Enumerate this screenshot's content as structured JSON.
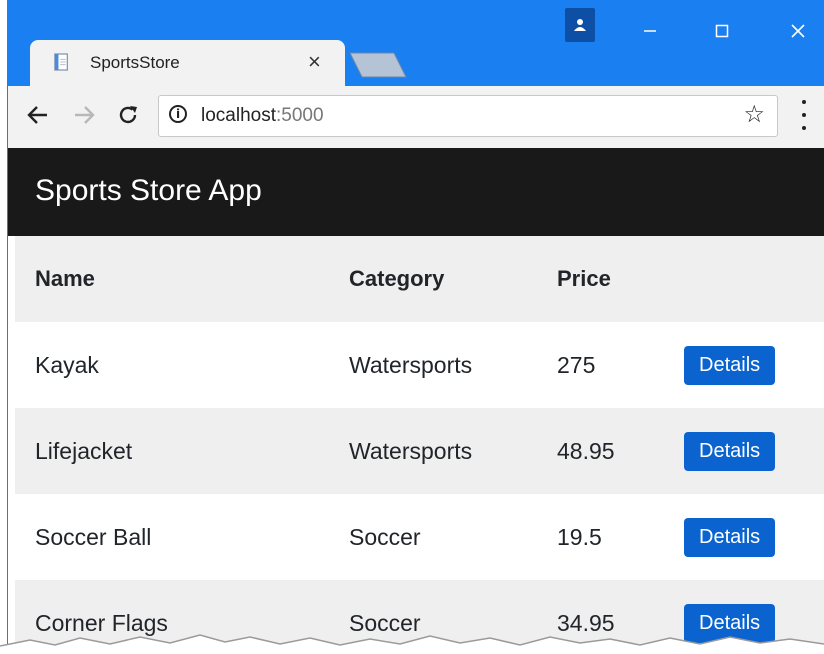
{
  "browser": {
    "tab_title": "SportsStore",
    "tab_close": "×",
    "url_host": "localhost",
    "url_port": ":5000",
    "info_glyph": "i"
  },
  "window_controls": [
    "minimize-icon",
    "maximize-icon",
    "close-icon"
  ],
  "app": {
    "brand": "Sports Store App"
  },
  "table": {
    "headers": [
      "Name",
      "Category",
      "Price"
    ],
    "rows": [
      {
        "name": "Kayak",
        "category": "Watersports",
        "price": "275",
        "action": "Details"
      },
      {
        "name": "Lifejacket",
        "category": "Watersports",
        "price": "48.95",
        "action": "Details"
      },
      {
        "name": "Soccer Ball",
        "category": "Soccer",
        "price": "19.5",
        "action": "Details"
      },
      {
        "name": "Corner Flags",
        "category": "Soccer",
        "price": "34.95",
        "action": "Details"
      }
    ]
  },
  "colors": {
    "titlebar": "#1a7ff0",
    "navbar": "#191919",
    "button": "#0a63cf"
  }
}
